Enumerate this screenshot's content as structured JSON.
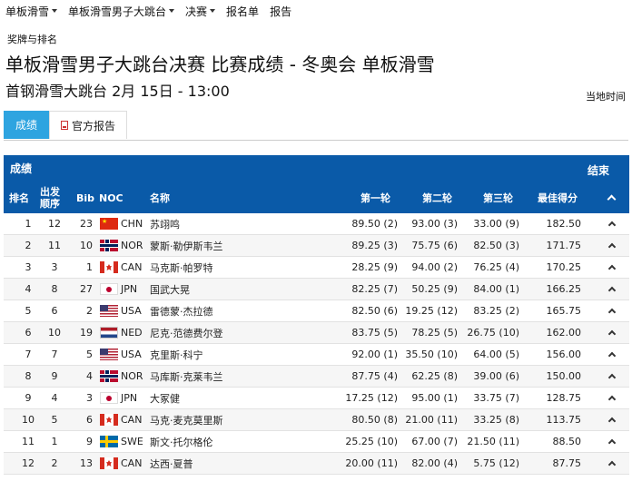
{
  "nav": {
    "items": [
      {
        "label": "单板滑雪",
        "dropdown": true
      },
      {
        "label": "单板滑雪男子大跳台",
        "dropdown": true
      },
      {
        "label": "决赛",
        "dropdown": true
      },
      {
        "label": "报名单",
        "dropdown": false
      },
      {
        "label": "报告",
        "dropdown": false
      }
    ],
    "sub": "奖牌与排名"
  },
  "header": {
    "title": "单板滑雪男子大跳台决赛 比赛成绩 - 冬奥会 单板滑雪",
    "subtitle": "首钢滑雪大跳台 2月 15日 - 13:00",
    "local_time": "当地时间"
  },
  "tabs": [
    {
      "label": "成绩",
      "active": true
    },
    {
      "label": "官方报告",
      "icon": "pdf-icon"
    }
  ],
  "results": {
    "label": "成绩",
    "status": "结束",
    "columns": {
      "rank": "排名",
      "order_line1": "出发",
      "order_line2": "顺序",
      "bib": "Bib",
      "noc": "NOC",
      "name": "名称",
      "r1": "第一轮",
      "r2": "第二轮",
      "r3": "第三轮",
      "best": "最佳得分"
    },
    "accent": "#0a5aa8",
    "rows": [
      {
        "rank": "1",
        "order": "12",
        "bib": "23",
        "noc": "CHN",
        "name": "苏翊鸣",
        "r1": "89.50 (2)",
        "r2": "93.00 (3)",
        "r3": "33.00 (9)",
        "best": "182.50"
      },
      {
        "rank": "2",
        "order": "11",
        "bib": "10",
        "noc": "NOR",
        "name": "蒙斯·勒伊斯韦兰",
        "r1": "89.25 (3)",
        "r2": "75.75 (6)",
        "r3": "82.50 (3)",
        "best": "171.75"
      },
      {
        "rank": "3",
        "order": "3",
        "bib": "1",
        "noc": "CAN",
        "name": "马克斯·帕罗特",
        "r1": "28.25 (9)",
        "r2": "94.00 (2)",
        "r3": "76.25 (4)",
        "best": "170.25"
      },
      {
        "rank": "4",
        "order": "8",
        "bib": "27",
        "noc": "JPN",
        "name": "国武大晃",
        "r1": "82.25 (7)",
        "r2": "50.25 (9)",
        "r3": "84.00 (1)",
        "best": "166.25"
      },
      {
        "rank": "5",
        "order": "6",
        "bib": "2",
        "noc": "USA",
        "name": "雷德蒙·杰拉德",
        "r1": "82.50 (6)",
        "r2": "19.25 (12)",
        "r3": "83.25 (2)",
        "best": "165.75"
      },
      {
        "rank": "6",
        "order": "10",
        "bib": "19",
        "noc": "NED",
        "name": "尼克·范德费尔登",
        "r1": "83.75 (5)",
        "r2": "78.25 (5)",
        "r3": "26.75 (10)",
        "best": "162.00"
      },
      {
        "rank": "7",
        "order": "7",
        "bib": "5",
        "noc": "USA",
        "name": "克里斯·科宁",
        "r1": "92.00 (1)",
        "r2": "35.50 (10)",
        "r3": "64.00 (5)",
        "best": "156.00"
      },
      {
        "rank": "8",
        "order": "9",
        "bib": "4",
        "noc": "NOR",
        "name": "马库斯·克莱韦兰",
        "r1": "87.75 (4)",
        "r2": "62.25 (8)",
        "r3": "39.00 (6)",
        "best": "150.00"
      },
      {
        "rank": "9",
        "order": "4",
        "bib": "3",
        "noc": "JPN",
        "name": "大冢健",
        "r1": "17.25 (12)",
        "r2": "95.00 (1)",
        "r3": "33.75 (7)",
        "best": "128.75"
      },
      {
        "rank": "10",
        "order": "5",
        "bib": "6",
        "noc": "CAN",
        "name": "马克·麦克莫里斯",
        "r1": "80.50 (8)",
        "r2": "21.00 (11)",
        "r3": "33.25 (8)",
        "best": "113.75"
      },
      {
        "rank": "11",
        "order": "1",
        "bib": "9",
        "noc": "SWE",
        "name": "斯文·托尔格伦",
        "r1": "25.25 (10)",
        "r2": "67.00 (7)",
        "r3": "21.50 (11)",
        "best": "88.50"
      },
      {
        "rank": "12",
        "order": "2",
        "bib": "13",
        "noc": "CAN",
        "name": "达西·夏普",
        "r1": "20.00 (11)",
        "r2": "82.00 (4)",
        "r3": "5.75 (12)",
        "best": "87.75"
      }
    ]
  }
}
